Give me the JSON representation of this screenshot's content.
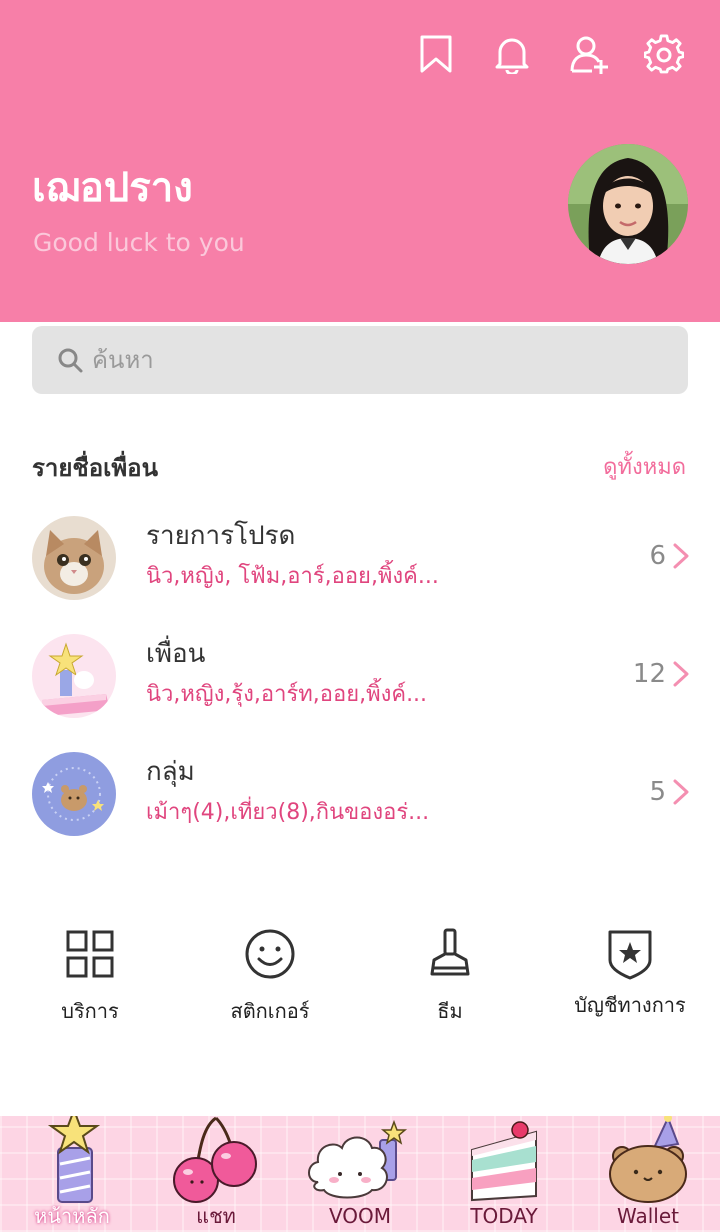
{
  "header": {
    "icons": [
      "bookmark-icon",
      "bell-icon",
      "add-friend-icon",
      "gear-icon"
    ],
    "profile_name": "เฌอปราง",
    "status_message": "Good luck to you"
  },
  "search": {
    "placeholder": "ค้นหา"
  },
  "friends_section": {
    "title": "รายชื่อเพื่อน",
    "see_all": "ดูทั้งหมด",
    "rows": [
      {
        "title": "รายการโปรด",
        "subtitle": "นิว,หญิง, โฟ้ม,อาร์,ออย,พิ้งค์...",
        "count": "6"
      },
      {
        "title": "เพื่อน",
        "subtitle": "นิว,หญิง,รุ้ง,อาร์ท,ออย,พิ้งค์...",
        "count": "12"
      },
      {
        "title": "กลุ่ม",
        "subtitle": "เม้าๆ(4),เที่ยว(8),กินของอร่...",
        "count": "5"
      }
    ]
  },
  "services": [
    {
      "label": "บริการ",
      "icon": "grid-icon"
    },
    {
      "label": "สติกเกอร์",
      "icon": "smiley-icon"
    },
    {
      "label": "ธีม",
      "icon": "paint-brush-icon"
    },
    {
      "label": "บัญชีทางการ",
      "icon": "shield-star-icon"
    }
  ],
  "tabbar": {
    "tabs": [
      {
        "label": "หน้าหลัก",
        "icon": "candle-icon"
      },
      {
        "label": "แชท",
        "icon": "cherry-icon"
      },
      {
        "label": "VOOM",
        "icon": "cloud-icon"
      },
      {
        "label": "TODAY",
        "icon": "cake-icon"
      },
      {
        "label": "Wallet",
        "icon": "bear-icon"
      }
    ]
  },
  "colors": {
    "header_bg": "#f77fa8",
    "accent": "#e0457e",
    "tabbar_bg": "#fdd5e4"
  }
}
